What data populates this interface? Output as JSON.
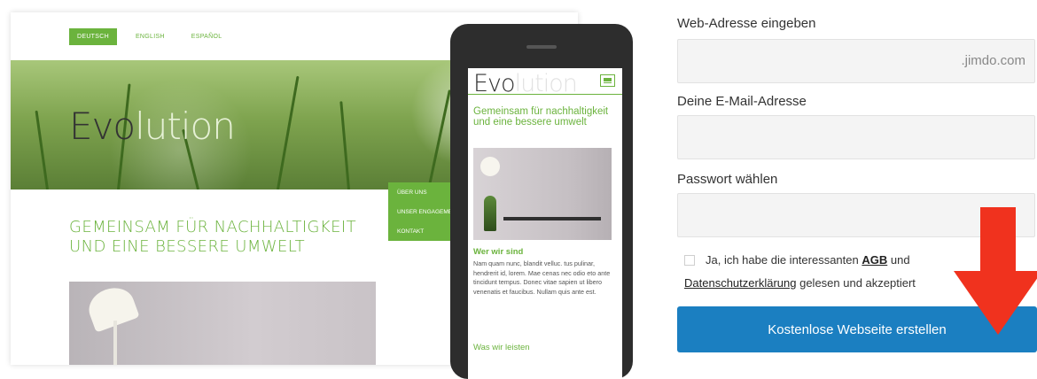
{
  "desktop_preview": {
    "languages": [
      {
        "label": "DEUTSCH",
        "active": true
      },
      {
        "label": "ENGLISH",
        "active": false
      },
      {
        "label": "ESPAÑOL",
        "active": false
      }
    ],
    "hero_title_dark": "Evo",
    "hero_title_light": "lution",
    "nav_items": [
      "ÜBER UNS",
      "UNSER ENGAGEMENT",
      "KONTAKT"
    ],
    "heading_line1": "GEMEINSAM FÜR NACHHALTIGKEIT",
    "heading_line2": "UND EINE BESSERE UMWELT"
  },
  "mobile_preview": {
    "logo_dark": "Evo",
    "logo_light": "lution",
    "menu_icon": "hamburger-icon",
    "heading": "Gemeinsam für nachhaltigkeit und eine bessere umwelt",
    "subheading1": "Wer wir sind",
    "body": "Nam quam nunc, blandit velluc. tus pulinar, hendrerit id, lorem. Mae cenas nec odio eto ante tincidunt tempus. Donec vitae sapien ut libero venenatis et faucibus. Nullam quis ante est.",
    "subheading2": "Was wir leisten"
  },
  "form": {
    "web_address_label": "Web-Adresse eingeben",
    "web_address_value": "",
    "web_address_suffix": ".jimdo.com",
    "email_label": "Deine E-Mail-Adresse",
    "email_value": "",
    "password_label": "Passwort wählen",
    "password_value": "",
    "terms_prefix": "Ja, ich habe die interessanten",
    "terms_agb": "AGB",
    "terms_und": "und",
    "terms_privacy": "Datenschutzerklärung",
    "terms_suffix": "gelesen und akzeptiert",
    "terms_checked": false,
    "submit_label": "Kostenlose Webseite erstellen"
  },
  "colors": {
    "brand_green": "#6bb33d",
    "button_blue": "#1b7fc1",
    "arrow_red": "#f0321e"
  }
}
